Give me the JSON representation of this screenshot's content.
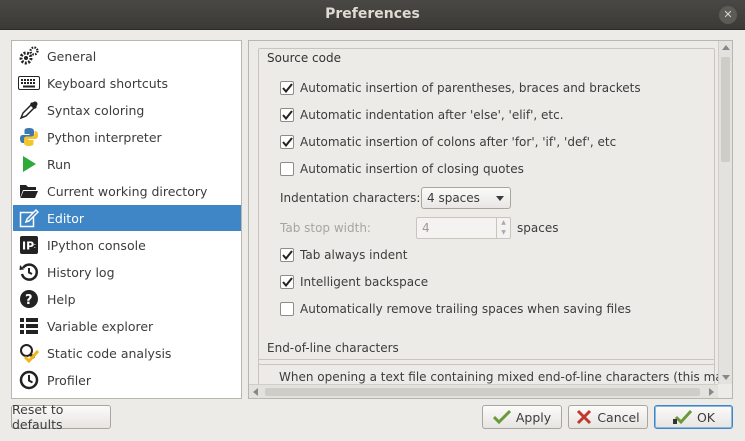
{
  "window": {
    "title": "Preferences"
  },
  "sidebar": {
    "items": [
      {
        "label": "General",
        "icon": "gears-icon"
      },
      {
        "label": "Keyboard shortcuts",
        "icon": "keyboard-icon"
      },
      {
        "label": "Syntax coloring",
        "icon": "eyedropper-icon"
      },
      {
        "label": "Python interpreter",
        "icon": "python-icon"
      },
      {
        "label": "Run",
        "icon": "play-icon"
      },
      {
        "label": "Current working directory",
        "icon": "folder-open-icon"
      },
      {
        "label": "Editor",
        "icon": "editor-icon",
        "selected": true
      },
      {
        "label": "IPython console",
        "icon": "ipython-icon"
      },
      {
        "label": "History log",
        "icon": "history-icon"
      },
      {
        "label": "Help",
        "icon": "help-icon"
      },
      {
        "label": "Variable explorer",
        "icon": "list-icon"
      },
      {
        "label": "Static code analysis",
        "icon": "analysis-icon"
      },
      {
        "label": "Profiler",
        "icon": "clock-icon"
      }
    ]
  },
  "editor": {
    "source_code_title": "Source code",
    "checks": [
      {
        "label": "Automatic insertion of parentheses, braces and brackets",
        "checked": true
      },
      {
        "label": "Automatic indentation after 'else', 'elif', etc.",
        "checked": true
      },
      {
        "label": "Automatic insertion of colons after 'for', 'if', 'def', etc",
        "checked": true
      },
      {
        "label": "Automatic insertion of closing quotes",
        "checked": false
      }
    ],
    "indentation_label": "Indentation characters:",
    "indentation_value": "4 spaces",
    "tab_stop_label": "Tab stop width:",
    "tab_stop_value": "4",
    "tab_stop_unit": "spaces",
    "checks2": [
      {
        "label": "Tab always indent",
        "checked": true
      },
      {
        "label": "Intelligent backspace",
        "checked": true
      },
      {
        "label": "Automatically remove trailing spaces when saving files",
        "checked": false
      }
    ],
    "eol_title": "End-of-line characters",
    "eol_text": "When opening a text file containing mixed end-of-line characters (this may raise"
  },
  "buttons": {
    "reset": "Reset to defaults",
    "apply": "Apply",
    "cancel": "Cancel",
    "ok": "OK"
  },
  "colors": {
    "selection": "#3e86c6",
    "titlebar": "#3b3a36"
  }
}
